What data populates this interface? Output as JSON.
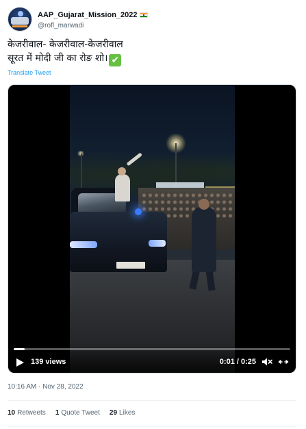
{
  "author": {
    "display_name": "AAP_Gujarat_Mission_2022",
    "handle": "@rofl_marwadi",
    "flag_icon": "india-flag-icon"
  },
  "tweet": {
    "lines": [
      "केजरीवाल- केजरीवाल-केजरीवाल",
      "सूरत में मोदी जी का रोङ शो।"
    ],
    "emoji": "✔",
    "translate_label": "Translate Tweet"
  },
  "video": {
    "views": "139 views",
    "time": "0:01 / 0:25",
    "progress_fraction": 0.04,
    "icons": [
      "play-icon",
      "mute-icon",
      "fullscreen-icon"
    ]
  },
  "meta": {
    "timestamp": "10:16 AM · Nov 28, 2022"
  },
  "stats": [
    {
      "count": "10",
      "label": "Retweets"
    },
    {
      "count": "1",
      "label": "Quote Tweet"
    },
    {
      "count": "29",
      "label": "Likes"
    }
  ],
  "colors": {
    "link": "#1d9bf0",
    "secondary_text": "#536471",
    "check_green": "#66c041"
  }
}
